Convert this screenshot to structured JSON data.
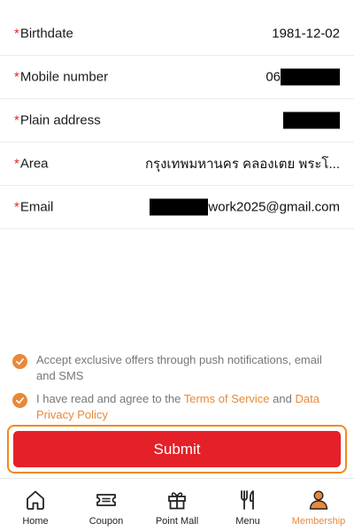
{
  "form": {
    "required_mark": "*",
    "fields": [
      {
        "label": "Birthdate",
        "value": "1981-12-02"
      },
      {
        "label": "Mobile number",
        "value": "06"
      },
      {
        "label": "Plain address",
        "value": ""
      },
      {
        "label": "Area",
        "value": "กรุงเทพมหานคร คลองเตย พระโ..."
      },
      {
        "label": "Email",
        "value": "work2025@gmail.com"
      }
    ]
  },
  "consents": [
    {
      "text": "Accept exclusive offers through push notifications, email and SMS",
      "checked": true
    },
    {
      "text_prefix": "I have read and agree to the ",
      "terms_link": "Terms of Service",
      "connector": " and ",
      "privacy_link": "Data Privacy Policy",
      "checked": true
    }
  ],
  "submit_label": "Submit",
  "tabbar": {
    "items": [
      {
        "label": "Home",
        "icon": "home-icon",
        "active": false
      },
      {
        "label": "Coupon",
        "icon": "coupon-icon",
        "active": false
      },
      {
        "label": "Point Mall",
        "icon": "gift-icon",
        "active": false
      },
      {
        "label": "Menu",
        "icon": "utensils-icon",
        "active": false
      },
      {
        "label": "Membership",
        "icon": "person-icon",
        "active": true
      }
    ]
  },
  "colors": {
    "accent": "#e8893a",
    "submit": "#e42028",
    "required": "#e0262b",
    "highlight_border": "#f08a1c"
  }
}
